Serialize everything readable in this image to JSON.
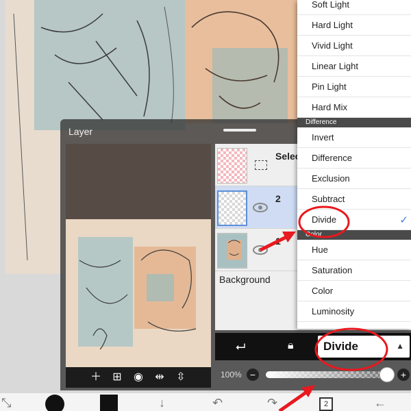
{
  "layer_panel": {
    "title": "Layer",
    "layers": [
      {
        "name": "Selec",
        "type": "selection"
      },
      {
        "name": "2",
        "type": "layer",
        "selected": true
      },
      {
        "name": "1",
        "type": "layer"
      }
    ],
    "background_label": "Background"
  },
  "blend": {
    "current": "Divide",
    "opacity_label": "100%",
    "opacity_value": 100
  },
  "blend_menu": {
    "items": [
      {
        "label": "Soft Light",
        "type": "item"
      },
      {
        "label": "Hard Light",
        "type": "item"
      },
      {
        "label": "Vivid Light",
        "type": "item"
      },
      {
        "label": "Linear Light",
        "type": "item"
      },
      {
        "label": "Pin Light",
        "type": "item"
      },
      {
        "label": "Hard Mix",
        "type": "item"
      },
      {
        "label": "Difference",
        "type": "section"
      },
      {
        "label": "Invert",
        "type": "item"
      },
      {
        "label": "Difference",
        "type": "item"
      },
      {
        "label": "Exclusion",
        "type": "item"
      },
      {
        "label": "Subtract",
        "type": "item"
      },
      {
        "label": "Divide",
        "type": "item",
        "checked": true
      },
      {
        "label": "Color",
        "type": "section"
      },
      {
        "label": "Hue",
        "type": "item"
      },
      {
        "label": "Saturation",
        "type": "item"
      },
      {
        "label": "Color",
        "type": "item"
      },
      {
        "label": "Luminosity",
        "type": "item"
      }
    ]
  },
  "bottom_bar": {
    "layer_count": "2"
  },
  "colors": {
    "accent": "#3b7de3",
    "annotation": "#e8191f",
    "panel_bg": "#343434"
  }
}
